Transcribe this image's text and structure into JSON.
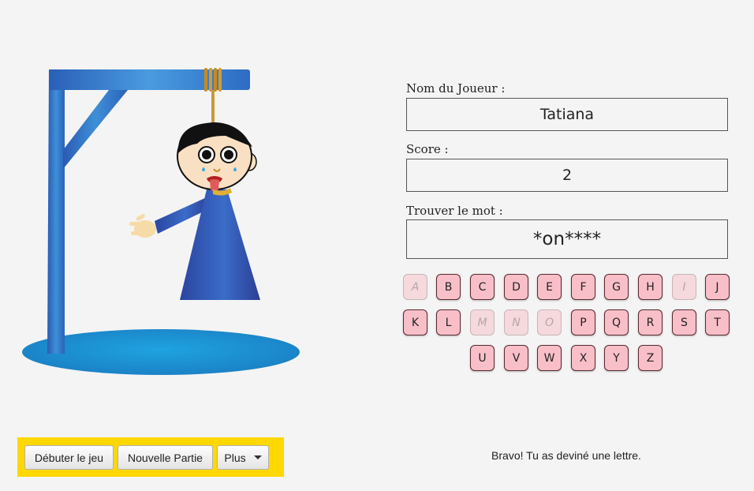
{
  "player": {
    "label": "Nom du Joueur :",
    "value": "Tatiana"
  },
  "score": {
    "label": "Score :",
    "value": "2"
  },
  "word": {
    "label": "Trouver le mot :",
    "value": "*on****"
  },
  "keyboard": {
    "rows": [
      [
        {
          "letter": "A",
          "used": true
        },
        {
          "letter": "B",
          "used": false
        },
        {
          "letter": "C",
          "used": false
        },
        {
          "letter": "D",
          "used": false
        },
        {
          "letter": "E",
          "used": false
        },
        {
          "letter": "F",
          "used": false
        },
        {
          "letter": "G",
          "used": false
        },
        {
          "letter": "H",
          "used": false
        },
        {
          "letter": "I",
          "used": true
        },
        {
          "letter": "J",
          "used": false
        }
      ],
      [
        {
          "letter": "K",
          "used": false
        },
        {
          "letter": "L",
          "used": false
        },
        {
          "letter": "M",
          "used": true
        },
        {
          "letter": "N",
          "used": true
        },
        {
          "letter": "O",
          "used": true
        },
        {
          "letter": "P",
          "used": false
        },
        {
          "letter": "Q",
          "used": false
        },
        {
          "letter": "R",
          "used": false
        },
        {
          "letter": "S",
          "used": false
        },
        {
          "letter": "T",
          "used": false
        }
      ],
      [
        {
          "letter": "U",
          "used": false
        },
        {
          "letter": "V",
          "used": false
        },
        {
          "letter": "W",
          "used": false
        },
        {
          "letter": "X",
          "used": false
        },
        {
          "letter": "Y",
          "used": false
        },
        {
          "letter": "Z",
          "used": false
        }
      ]
    ]
  },
  "toolbar": {
    "start_label": "Débuter le jeu",
    "new_game_label": "Nouvelle Partie",
    "more_label": "Plus"
  },
  "status": "Bravo! Tu as deviné une lettre.",
  "colors": {
    "background": "#f4f4f4",
    "key_fill": "#f9bfc9",
    "key_used_fill": "#f5d9dd",
    "toolbar": "#ffd800",
    "gallows": "#2f6fc0",
    "robe": "#2f4fa8"
  }
}
